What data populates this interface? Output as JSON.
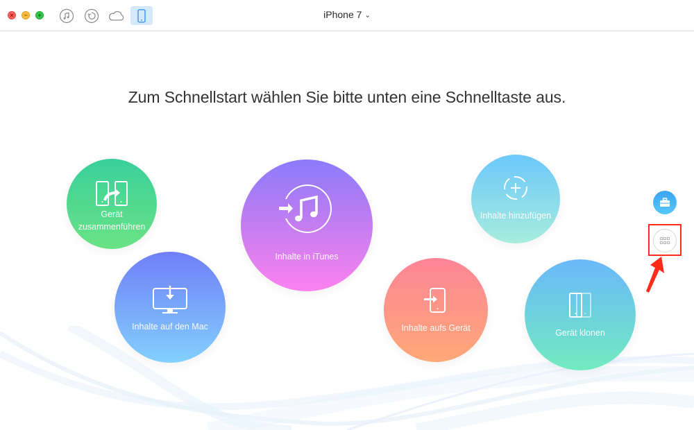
{
  "window": {
    "controls": [
      {
        "name": "close",
        "glyph": "×"
      },
      {
        "name": "minimize",
        "glyph": "−"
      },
      {
        "name": "zoom",
        "glyph": "+"
      }
    ],
    "toolbar_icons": [
      "music-icon",
      "restore-icon",
      "cloud-icon",
      "phone-icon"
    ],
    "active_toolbar_icon": "phone-icon",
    "device_name": "iPhone 7",
    "device_chevron": "⌄"
  },
  "main": {
    "headline": "Zum Schnellstart wählen Sie bitte unten eine Schnelltaste aus.",
    "actions": [
      {
        "id": "merge",
        "label_line1": "Gerät",
        "label_line2": "zusammenführen",
        "icon": "merge-devices-icon",
        "gradient": [
          "#39cf9c",
          "#6ae384"
        ]
      },
      {
        "id": "to-mac",
        "label": "Inhalte auf den Mac",
        "icon": "monitor-download-icon",
        "gradient": [
          "#6f7ff8",
          "#83d0fd"
        ]
      },
      {
        "id": "to-itunes",
        "label": "Inhalte in iTunes",
        "icon": "itunes-import-icon",
        "gradient": [
          "#8b7bfb",
          "#fc82ef"
        ]
      },
      {
        "id": "add",
        "label": "Inhalte hinzufügen",
        "icon": "add-content-icon",
        "gradient": [
          "#6cc8fb",
          "#a7ecdd"
        ]
      },
      {
        "id": "to-device",
        "label": "Inhalte aufs Gerät",
        "icon": "phone-import-icon",
        "gradient": [
          "#fd8597",
          "#ffa877"
        ]
      },
      {
        "id": "clone",
        "label": "Gerät klonen",
        "icon": "clone-device-icon",
        "gradient": [
          "#6ab8fa",
          "#72ebc0"
        ]
      }
    ]
  },
  "side": {
    "toolbox_icon": "toolbox-icon",
    "grid_icon": "grid-icon",
    "highlight_color": "#ff2a1a"
  }
}
